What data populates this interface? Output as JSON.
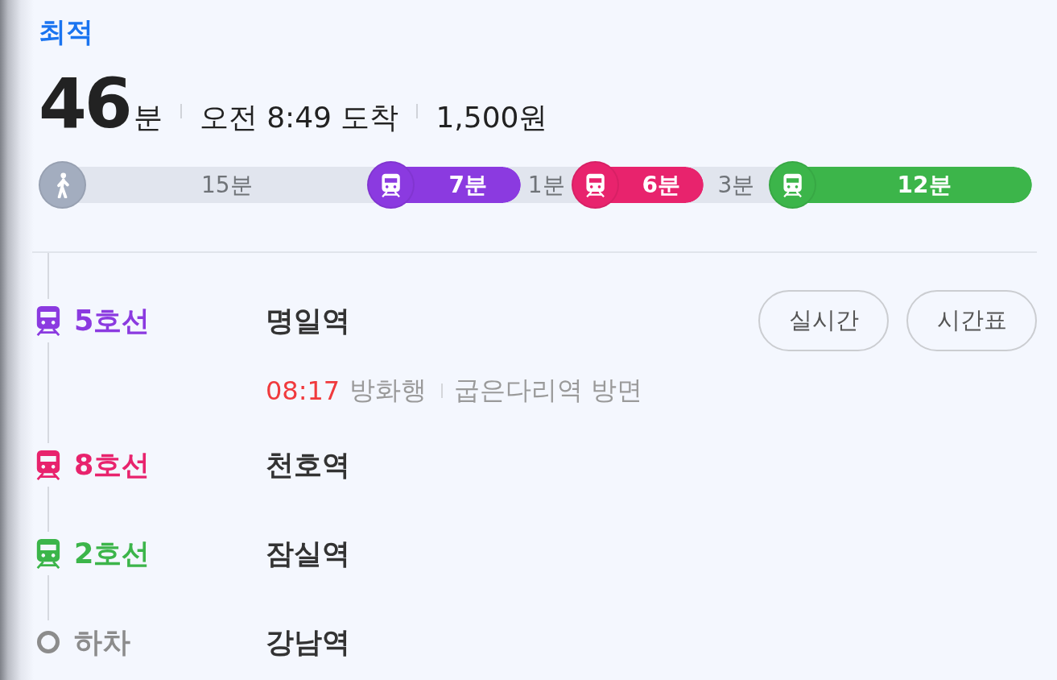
{
  "route": {
    "label": "최적",
    "duration": "46",
    "duration_unit": "분",
    "arrival": "오전 8:49 도착",
    "fare": "1,500원"
  },
  "timeline": [
    {
      "kind": "walk",
      "label": "15분"
    },
    {
      "kind": "subway",
      "label": "7분",
      "color": "#8b3ae0"
    },
    {
      "kind": "transfer",
      "label": "1분"
    },
    {
      "kind": "subway",
      "label": "6분",
      "color": "#e8236d"
    },
    {
      "kind": "transfer",
      "label": "3분"
    },
    {
      "kind": "subway",
      "label": "12분",
      "color": "#3cb54a"
    }
  ],
  "steps": [
    {
      "kind": "subway",
      "line": "5호선",
      "color": "#8b3ae0",
      "station": "명일역",
      "buttons": [
        "실시간",
        "시간표"
      ],
      "departure": {
        "time": "08:17",
        "destination": "방화행",
        "direction": "굽은다리역 방면"
      }
    },
    {
      "kind": "subway",
      "line": "8호선",
      "color": "#e8236d",
      "station": "천호역"
    },
    {
      "kind": "subway",
      "line": "2호선",
      "color": "#3cb54a",
      "station": "잠실역"
    },
    {
      "kind": "exit",
      "line": "하차",
      "station": "강남역"
    }
  ]
}
